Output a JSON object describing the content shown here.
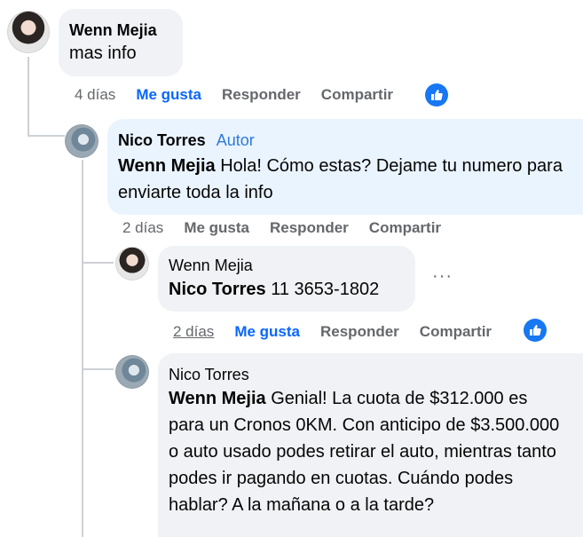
{
  "comments": [
    {
      "author": "Wenn Mejia",
      "text": "mas info",
      "time": "4 días",
      "like": "Me gusta",
      "reply": "Responder",
      "share": "Compartir"
    },
    {
      "author": "Nico Torres",
      "badge": "Autor",
      "mention": "Wenn Mejia",
      "text": " Hola! Cómo estas? Dejame tu numero para enviarte toda la info",
      "time": "2 días",
      "like": "Me gusta",
      "reply": "Responder",
      "share": "Compartir"
    },
    {
      "author": "Wenn Mejia",
      "mention": "Nico Torres",
      "text": " 11 3653-1802",
      "time": "2 días",
      "like": "Me gusta",
      "reply": "Responder",
      "share": "Compartir",
      "more": "···"
    },
    {
      "author": "Nico Torres",
      "mention": "Wenn Mejia",
      "text": " Genial! La cuota de $312.000 es para un Cronos 0KM. Con anticipo de $3.500.000 o auto usado podes retirar el auto, mientras tanto podes ir pagando en cuotas. Cuándo podes hablar? A la mañana o a la tarde?"
    }
  ],
  "colors": {
    "accent": "#0866ff",
    "author_badge": "#2f7ad9",
    "bubble_grey": "#f0f2f5",
    "bubble_blue": "#eaf4ff",
    "react": "#1877f2"
  },
  "icons": [
    "like-reaction-icon",
    "more-options-icon"
  ]
}
